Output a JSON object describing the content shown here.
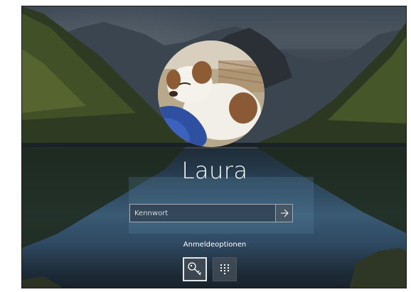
{
  "user": {
    "name": "Laura",
    "avatar_icon": "user-avatar"
  },
  "password": {
    "placeholder": "Kennwort",
    "value": ""
  },
  "submit_icon": "arrow-right-icon",
  "signin_options": {
    "label": "Anmeldeoptionen",
    "items": [
      {
        "icon": "key-icon",
        "selected": true
      },
      {
        "icon": "pin-keypad-icon",
        "selected": false
      }
    ]
  }
}
